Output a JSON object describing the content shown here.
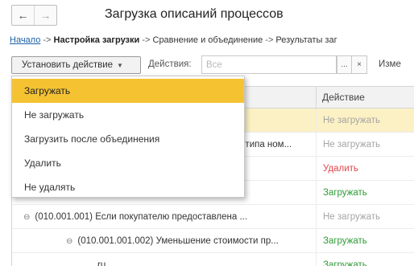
{
  "nav": {
    "back_glyph": "←",
    "forward_glyph": "→",
    "back_icon": "arrow-left-icon",
    "forward_icon": "arrow-right-icon"
  },
  "page_title": "Загрузка описаний процессов",
  "breadcrumb": {
    "start": "Начало",
    "sep1": " -> ",
    "current": "Настройка загрузки",
    "sep2": " -> ",
    "step3": "Сравнение и объединение",
    "sep3": " -> ",
    "step4": "Результаты заг"
  },
  "toolbar": {
    "set_action_label": "Установить действие",
    "actions_label": "Действия:",
    "actions_placeholder": "Все",
    "dots_label": "...",
    "clear_label": "×",
    "change_label": "Изме"
  },
  "grid": {
    "action_header": "Действие",
    "rows": [
      {
        "name": "",
        "action": "Не загружать"
      },
      {
        "name": "я типа ном...",
        "action": "Не загружать"
      },
      {
        "name": "",
        "action": "Удалить"
      },
      {
        "name": "",
        "action": "Загружать"
      },
      {
        "name": "(010.001.001) Если покупателю предоставлена ...",
        "action": "Не загружать",
        "toggle": "⊖"
      },
      {
        "name": "(010.001.001.002) Уменьшение стоимости пр...",
        "action": "Загружать",
        "toggle": "⊖"
      },
      {
        "name": "ru",
        "action": "Загружать"
      }
    ]
  },
  "dropdown": {
    "items": [
      "Загружать",
      "Не загружать",
      "Загрузить после объединения",
      "Удалить",
      "Не удалять"
    ],
    "selected_index": 0
  },
  "colors": {
    "load": "#2e9a36",
    "no_load": "#a5a5a5",
    "delete": "#e0464b",
    "selected": "#f5c332",
    "row_highlight": "#fbf1c4",
    "link": "#1c5fa8"
  }
}
